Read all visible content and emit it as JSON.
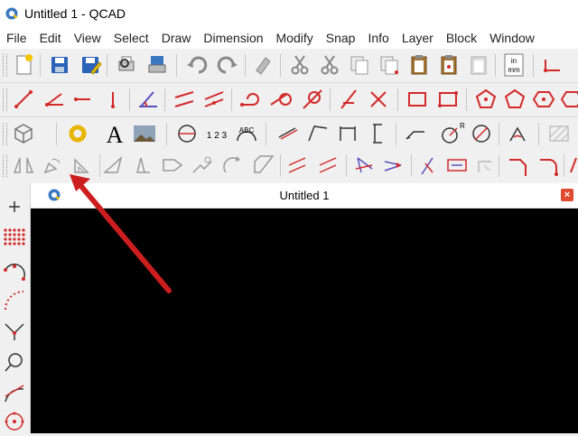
{
  "window": {
    "title": "Untitled 1 - QCAD",
    "icon": "qcad-logo-icon"
  },
  "menu": {
    "items": [
      "File",
      "Edit",
      "View",
      "Select",
      "Draw",
      "Dimension",
      "Modify",
      "Snap",
      "Info",
      "Layer",
      "Block",
      "Window"
    ]
  },
  "toolbars": {
    "file": [
      "new-document-icon",
      "open-icon",
      "save-icon",
      "save-as-icon",
      "print-preview-icon",
      "print-icon",
      "undo-icon",
      "redo-icon",
      "eraser-icon",
      "cut-icon",
      "cut-reference-icon",
      "copy-icon",
      "copy-reference-icon",
      "paste-icon",
      "clipboard-icon",
      "clipboard-export-icon",
      "unit-icon"
    ],
    "unit_label": "in\nmm",
    "draw": [
      "line-icon",
      "line-angle-icon",
      "line-horizontal-icon",
      "line-vertical-icon",
      "line-tangent-icon",
      "line-parallel-icon",
      "line-parallel-through-icon",
      "arc-icon",
      "circle-tangent-icon",
      "arc-tangent-icon",
      "line-bisector-icon",
      "line-orthogonal-icon",
      "rectangle-icon",
      "rectangle-corners-icon",
      "polygon-icon",
      "polygon-corner-icon",
      "polygon-side-icon",
      "polygon-hexagon-icon"
    ],
    "misc": [
      "3d-box-icon",
      "ring-icon",
      "text-icon",
      "image-icon",
      "dimension-circle-icon",
      "numbering-icon",
      "text-arc-icon",
      "dim-aligned-icon",
      "dim-angular-icon",
      "dim-horizontal-icon",
      "dim-vertical-icon",
      "leader-icon",
      "dim-radial-icon",
      "dim-diameter-icon",
      "dim-angle-icon",
      "hatch-icon"
    ],
    "text_glyph": "A",
    "numbering_glyph": "1 2 3",
    "radial_glyph": "R",
    "modify": [
      "mirror-icon",
      "rotate-icon",
      "scale-icon",
      "move-icon",
      "stretch-icon",
      "shear-icon",
      "align-icon",
      "rotate2-icon",
      "bevel-icon",
      "offset-icon",
      "offset-through-icon",
      "move-rotate-icon",
      "rotate-selection-icon",
      "edit-properties-icon",
      "explode-icon",
      "trim-icon",
      "chamfer-icon",
      "fillet-icon"
    ],
    "left": [
      "crosshair-icon",
      "point-grid-icon",
      "polyline-icon",
      "spline-icon",
      "tangent-icon",
      "circle-point-icon",
      "arc-point-icon",
      "circle-center-icon"
    ]
  },
  "document": {
    "title": "Untitled 1",
    "close_label": "×"
  },
  "colors": {
    "accent_red": "#d42a2a",
    "canvas_bg": "#000000",
    "annotation_arrow": "#cc1e1e"
  }
}
